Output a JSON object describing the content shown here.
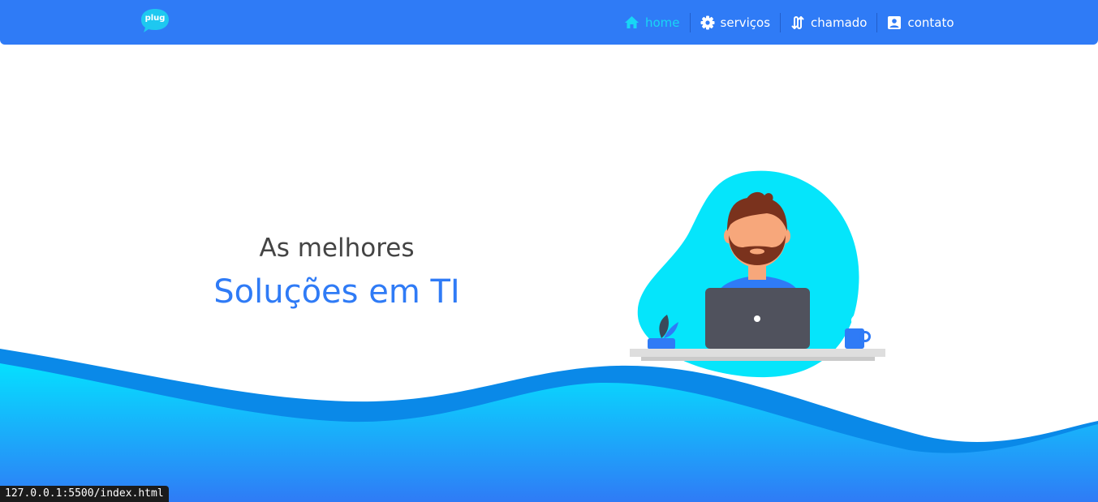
{
  "header": {
    "logo_text": "plug",
    "nav": [
      {
        "label": "home",
        "icon": "home-icon",
        "active": true
      },
      {
        "label": "serviços",
        "icon": "gear-icon",
        "active": false
      },
      {
        "label": "chamado",
        "icon": "swap-icon",
        "active": false
      },
      {
        "label": "contato",
        "icon": "contact-card-icon",
        "active": false
      }
    ]
  },
  "hero": {
    "line1": "As melhores",
    "line2": "Soluções em TI"
  },
  "status_bar": {
    "url": "127.0.0.1:5500/index.html"
  },
  "colors": {
    "primary": "#2f7bf6",
    "accent": "#18d6f5",
    "text_dark": "#444444"
  }
}
